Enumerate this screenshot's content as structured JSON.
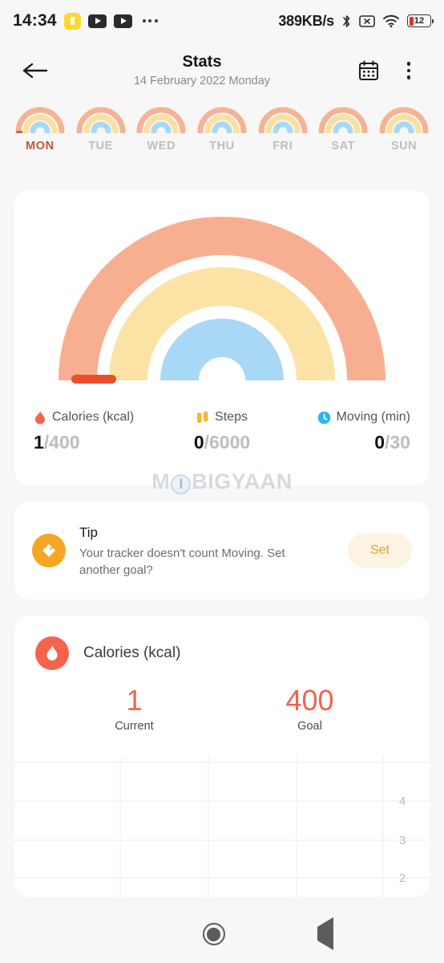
{
  "statusbar": {
    "time": "14:34",
    "network_speed": "389KB/s",
    "battery_level": "12",
    "icons": [
      "shield-icon",
      "video-icon",
      "video-icon",
      "more-dots-icon",
      "bluetooth-icon",
      "sim-disabled-icon",
      "wifi-icon",
      "battery-icon"
    ]
  },
  "appbar": {
    "back_icon": "arrow-left-icon",
    "title": "Stats",
    "subtitle": "14 February 2022 Monday",
    "calendar_icon": "calendar-icon",
    "menu_icon": "kebab-menu-icon"
  },
  "days": [
    {
      "label": "MON",
      "active": true
    },
    {
      "label": "TUE",
      "active": false
    },
    {
      "label": "WED",
      "active": false
    },
    {
      "label": "THU",
      "active": false
    },
    {
      "label": "FRI",
      "active": false
    },
    {
      "label": "SAT",
      "active": false
    },
    {
      "label": "SUN",
      "active": false
    }
  ],
  "rings": {
    "outer_color": "#f8af91",
    "middle_color": "#fae3a4",
    "inner_color": "#a8d8f5",
    "progress_cap_color": "#e8502b"
  },
  "stats": [
    {
      "icon": "flame-icon",
      "icon_color": "#f4634a",
      "label": "Calories (kcal)",
      "current": "1",
      "goal": "/400"
    },
    {
      "icon": "footsteps-icon",
      "icon_color": "#f5b82e",
      "label": "Steps",
      "current": "0",
      "goal": "/6000"
    },
    {
      "icon": "clock-icon",
      "icon_color": "#29b6f6",
      "label": "Moving (min)",
      "current": "0",
      "goal": "/30"
    }
  ],
  "watermark": {
    "part1": "M",
    "part2": "BIGYAAN"
  },
  "tip": {
    "icon": "tag-icon",
    "title": "Tip",
    "body": "Your tracker doesn't count Moving. Set another goal?",
    "button_label": "Set"
  },
  "calories_card": {
    "icon": "flame-icon",
    "title": "Calories (kcal)",
    "current_value": "1",
    "current_label": "Current",
    "goal_value": "400",
    "goal_label": "Goal",
    "accent_color": "#f4634a"
  },
  "chart_data": {
    "type": "bar",
    "title": "Calories (kcal)",
    "xlabel": "",
    "ylabel": "",
    "categories": [
      "",
      "",
      "",
      "",
      ""
    ],
    "values": [
      0,
      0,
      0,
      0,
      0
    ],
    "yticks": [
      "4",
      "3",
      "2"
    ],
    "ytick_positions": [
      4,
      3,
      2
    ],
    "ylim": [
      1,
      5
    ],
    "grid": true,
    "legend": "none",
    "note": "chart is clipped at the bottom of the viewport; only empty gridlines and right-side y tick labels are visible"
  },
  "navbar": {
    "recents_icon": "square-icon",
    "home_icon": "circle-icon",
    "back_icon": "triangle-back-icon"
  }
}
